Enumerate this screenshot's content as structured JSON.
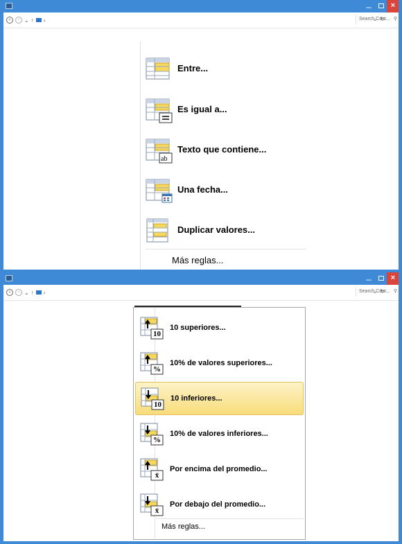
{
  "window1": {
    "search_placeholder": "Search Cont...",
    "menu": {
      "items": [
        {
          "label": "Entre...",
          "icon": "between-icon",
          "accel": "E"
        },
        {
          "label": "Es igual a...",
          "icon": "equal-to-icon",
          "accel": "E"
        },
        {
          "label": "Texto que contiene...",
          "icon": "text-contains-icon",
          "accel": "T"
        },
        {
          "label": "Una fecha...",
          "icon": "date-occurring-icon",
          "accel": "U"
        },
        {
          "label": "Duplicar valores...",
          "icon": "duplicate-values-icon",
          "accel": "D"
        }
      ],
      "more_rules": "Más reglas..."
    }
  },
  "window2": {
    "search_placeholder": "Search Cont...",
    "menu": {
      "items": [
        {
          "label": "10 superiores...",
          "icon": "top-10-icon",
          "badge": "10",
          "arrow": "up",
          "highlighted": false
        },
        {
          "label": "10% de valores superiores...",
          "icon": "top-10-percent-icon",
          "badge": "%",
          "arrow": "up",
          "highlighted": false
        },
        {
          "label": "10 inferiores...",
          "icon": "bottom-10-icon",
          "badge": "10",
          "arrow": "down",
          "highlighted": true
        },
        {
          "label": "10% de valores inferiores...",
          "icon": "bottom-10-percent-icon",
          "badge": "%",
          "arrow": "down",
          "highlighted": false
        },
        {
          "label": "Por encima del promedio...",
          "icon": "above-average-icon",
          "badge": "x̄",
          "arrow": "up",
          "highlighted": false
        },
        {
          "label": "Por debajo del promedio...",
          "icon": "below-average-icon",
          "badge": "x̄",
          "arrow": "down",
          "highlighted": false
        }
      ],
      "more_rules": "Más reglas..."
    }
  },
  "colors": {
    "titlebar": "#3f8ad6",
    "close": "#d9453b",
    "highlight": "#f8dc7a"
  }
}
